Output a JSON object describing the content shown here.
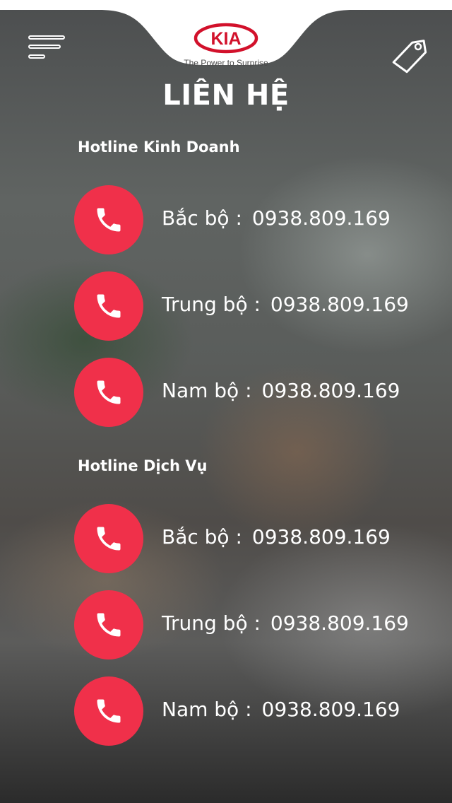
{
  "app": {
    "brand_logo_text": "KIA",
    "tagline": "The Power to Surprise",
    "accent_color": "#f0304a",
    "header": {
      "menu_icon": "menu-icon",
      "tag_icon": "tag-icon"
    }
  },
  "page": {
    "title": "LIÊN HỆ"
  },
  "sections": [
    {
      "heading": "Hotline Kinh Doanh",
      "items": [
        {
          "icon": "phone-icon",
          "region": "Bắc bộ :",
          "phone": "0938.809.169"
        },
        {
          "icon": "phone-icon",
          "region": "Trung bộ :",
          "phone": "0938.809.169"
        },
        {
          "icon": "phone-icon",
          "region": "Nam bộ :",
          "phone": "0938.809.169"
        }
      ]
    },
    {
      "heading": "Hotline Dịch Vụ",
      "items": [
        {
          "icon": "phone-icon",
          "region": "Bắc bộ :",
          "phone": "0938.809.169"
        },
        {
          "icon": "phone-icon",
          "region": "Trung bộ :",
          "phone": "0938.809.169"
        },
        {
          "icon": "phone-icon",
          "region": "Nam bộ :",
          "phone": "0938.809.169"
        }
      ]
    }
  ]
}
